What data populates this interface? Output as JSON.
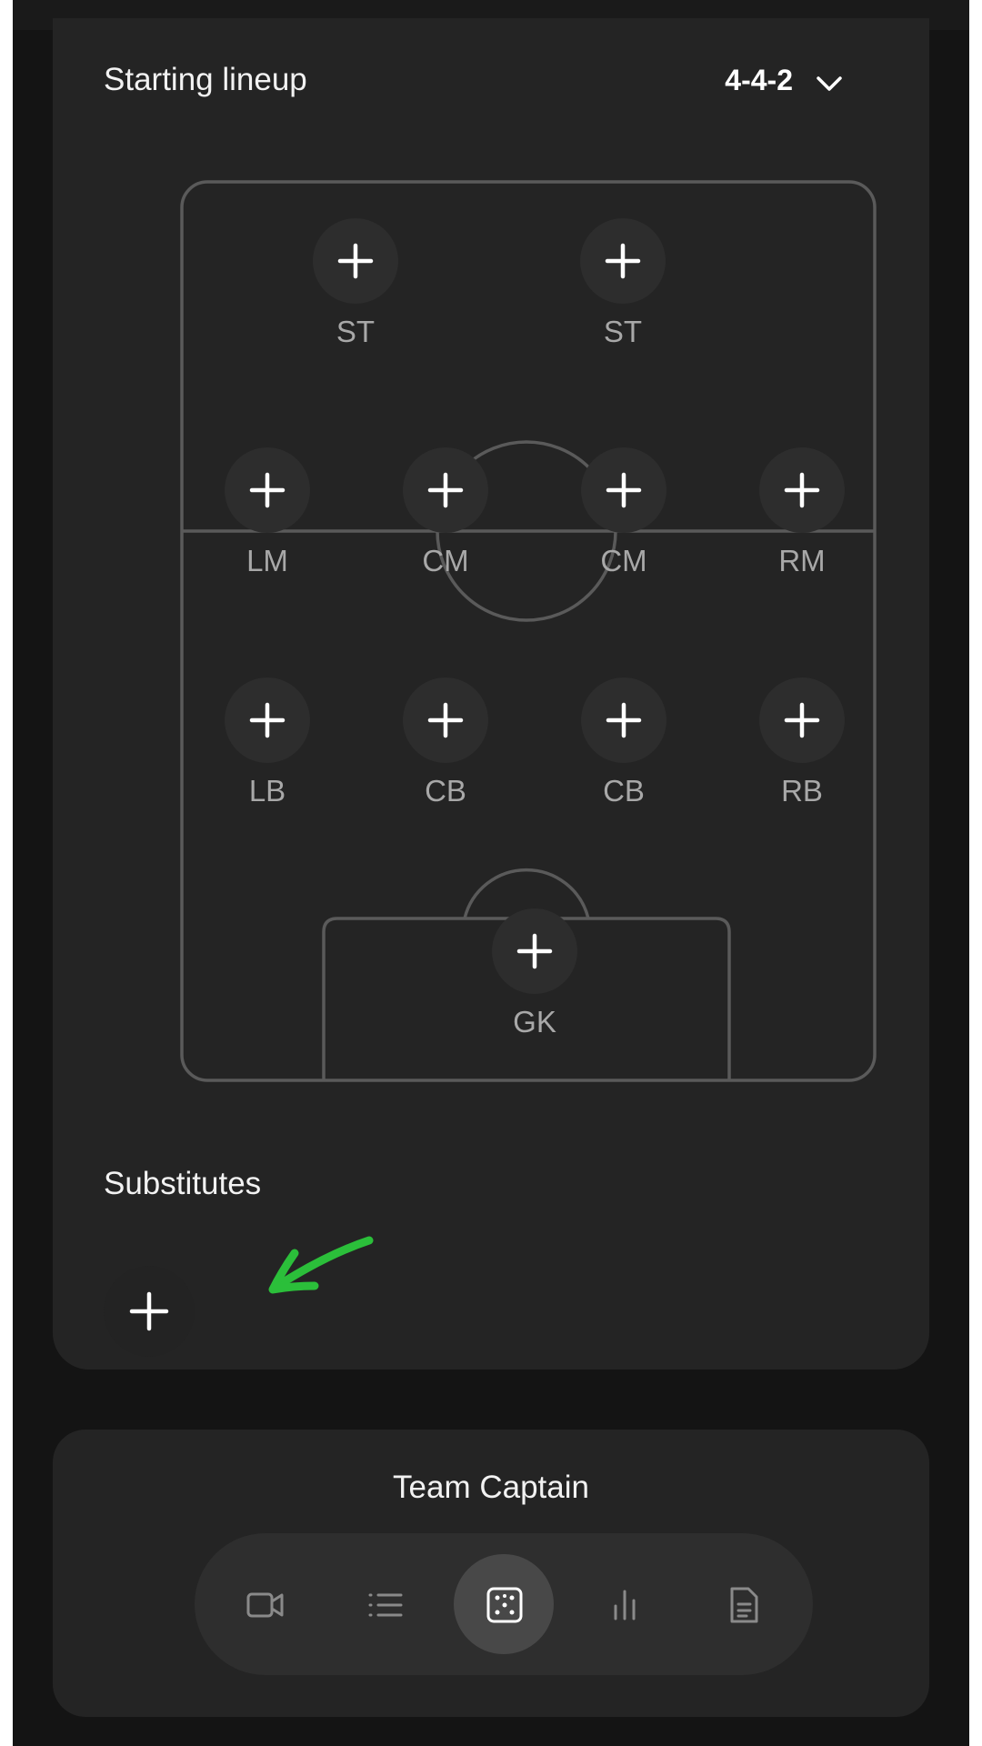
{
  "lineup": {
    "title": "Starting lineup",
    "formation": "4-4-2",
    "positions": {
      "st1": "ST",
      "st2": "ST",
      "lm": "LM",
      "cm1": "CM",
      "cm2": "CM",
      "rm": "RM",
      "lb": "LB",
      "cb1": "CB",
      "cb2": "CB",
      "rb": "RB",
      "gk": "GK"
    }
  },
  "substitutes": {
    "title": "Substitutes"
  },
  "captain": {
    "title": "Team Captain"
  },
  "nav": {
    "items": [
      "video-icon",
      "list-icon",
      "lineup-dice-icon",
      "stats-bars-icon",
      "document-icon"
    ],
    "active": "lineup-dice-icon"
  },
  "colors": {
    "annotation_arrow": "#2bbf3a"
  }
}
